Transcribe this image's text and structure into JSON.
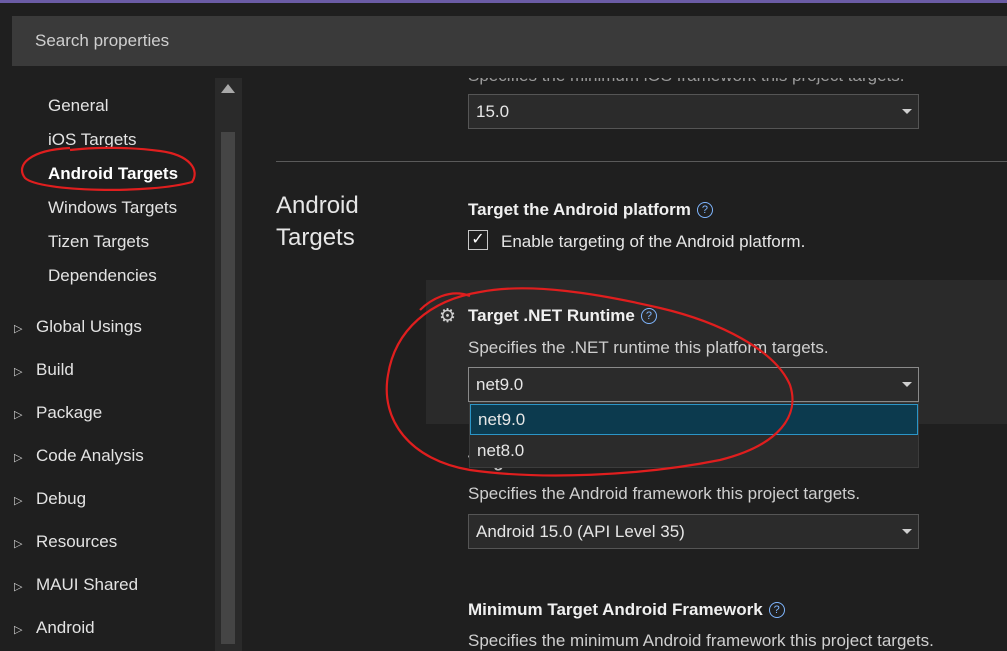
{
  "search": {
    "placeholder": "Search properties"
  },
  "sidebar": {
    "items": [
      {
        "label": "General"
      },
      {
        "label": "iOS Targets"
      },
      {
        "label": "Android Targets"
      },
      {
        "label": "Windows Targets"
      },
      {
        "label": "Tizen Targets"
      },
      {
        "label": "Dependencies"
      }
    ],
    "groups": [
      {
        "label": "Global Usings"
      },
      {
        "label": "Build"
      },
      {
        "label": "Package"
      },
      {
        "label": "Code Analysis"
      },
      {
        "label": "Debug"
      },
      {
        "label": "Resources"
      },
      {
        "label": "MAUI Shared"
      },
      {
        "label": "Android"
      }
    ]
  },
  "ios": {
    "desc": "Specifies the minimum iOS framework this project targets.",
    "value": "15.0"
  },
  "android": {
    "section_title_line1": "Android",
    "section_title_line2": "Targets",
    "platform": {
      "label": "Target the Android platform",
      "checkbox_label": "Enable targeting of the Android platform.",
      "checked": true
    },
    "runtime": {
      "label": "Target .NET Runtime",
      "desc": "Specifies the .NET runtime this platform targets.",
      "value": "net9.0",
      "options": [
        "net9.0",
        "net8.0"
      ]
    },
    "framework": {
      "label_partial": "Target Android Framework",
      "desc": "Specifies the Android framework this project targets.",
      "value": "Android 15.0 (API Level 35)"
    },
    "min_framework": {
      "label": "Minimum Target Android Framework",
      "desc": "Specifies the minimum Android framework this project targets."
    }
  },
  "icons": {
    "help": "?",
    "check": "✓",
    "chevron": "▷",
    "gear": "⚙"
  },
  "colors": {
    "annotation": "#e01e1e",
    "accent": "#2b95c7"
  }
}
